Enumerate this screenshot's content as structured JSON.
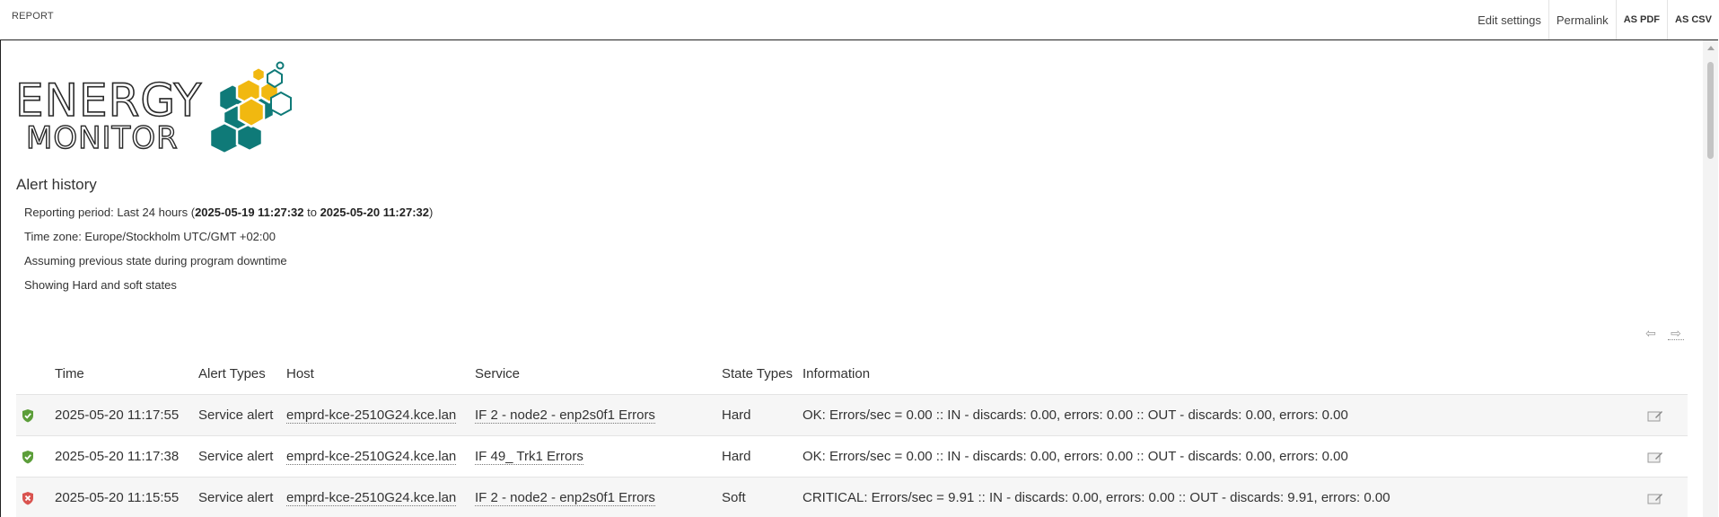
{
  "topbar": {
    "title": "REPORT",
    "actions": {
      "edit_settings": "Edit settings",
      "permalink": "Permalink",
      "as_pdf": "AS PDF",
      "as_csv": "AS CSV"
    }
  },
  "logo": {
    "line1": "ENERGY",
    "line2": "MONITOR"
  },
  "report": {
    "heading": "Alert history",
    "period_prefix": "Reporting period: Last 24 hours (",
    "period_start": "2025-05-19 11:27:32",
    "period_to": " to ",
    "period_end": "2025-05-20 11:27:32",
    "period_suffix": ")",
    "timezone": "Time zone: Europe/Stockholm UTC/GMT +02:00",
    "assumption": "Assuming previous state during program downtime",
    "states": "Showing Hard and soft states"
  },
  "pager": {
    "prev": "⇦",
    "next": "⇨"
  },
  "table": {
    "headers": [
      "Time",
      "Alert Types",
      "Host",
      "Service",
      "State Types",
      "Information"
    ],
    "rows": [
      {
        "status": "ok",
        "time": "2025-05-20 11:17:55",
        "alert_type": "Service alert",
        "host": "emprd-kce-2510G24.kce.lan",
        "service": "IF 2 - node2 - enp2s0f1 Errors",
        "state_type": "Hard",
        "info": "OK: Errors/sec = 0.00 :: IN - discards: 0.00, errors: 0.00 :: OUT - discards: 0.00, errors: 0.00"
      },
      {
        "status": "ok",
        "time": "2025-05-20 11:17:38",
        "alert_type": "Service alert",
        "host": "emprd-kce-2510G24.kce.lan",
        "service": "IF 49_ Trk1 Errors",
        "state_type": "Hard",
        "info": "OK: Errors/sec = 0.00 :: IN - discards: 0.00, errors: 0.00 :: OUT - discards: 0.00, errors: 0.00"
      },
      {
        "status": "critical",
        "time": "2025-05-20 11:15:55",
        "alert_type": "Service alert",
        "host": "emprd-kce-2510G24.kce.lan",
        "service": "IF 2 - node2 - enp2s0f1 Errors",
        "state_type": "Soft",
        "info": "CRITICAL: Errors/sec = 9.91 :: IN - discards: 0.00, errors: 0.00 :: OUT - discards: 9.91, errors: 0.00"
      }
    ]
  },
  "colors": {
    "ok": "#5c9e3a",
    "critical": "#d9534f",
    "logo_teal": "#0f7a78",
    "logo_yellow": "#f1b810"
  }
}
